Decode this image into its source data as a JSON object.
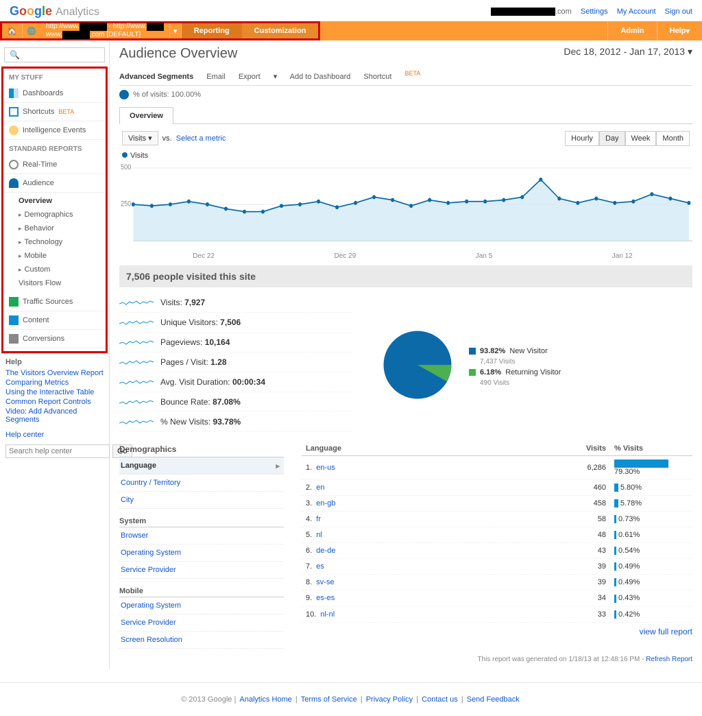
{
  "header": {
    "logo_analytics": "Analytics",
    "email_suffix": ".com",
    "links": {
      "settings": "Settings",
      "my_account": "My Account",
      "sign_out": "Sign out"
    }
  },
  "nav": {
    "breadcrumb_top": "http://www.",
    "breadcrumb_mid": " - http://www.",
    "breadcrumb_bottom": ".com [DEFAULT]",
    "reporting": "Reporting",
    "customization": "Customization",
    "admin": "Admin",
    "help": "Help"
  },
  "sidebar": {
    "my_stuff": "MY STUFF",
    "dashboards": "Dashboards",
    "shortcuts": "Shortcuts",
    "beta": "BETA",
    "intelligence": "Intelligence Events",
    "standard": "STANDARD REPORTS",
    "realtime": "Real-Time",
    "audience": "Audience",
    "sub": {
      "overview": "Overview",
      "demographics": "Demographics",
      "behavior": "Behavior",
      "technology": "Technology",
      "mobile": "Mobile",
      "custom": "Custom",
      "visitors_flow": "Visitors Flow"
    },
    "traffic_sources": "Traffic Sources",
    "content": "Content",
    "conversions": "Conversions",
    "help": "Help",
    "help_links": [
      "The Visitors Overview Report",
      "Comparing Metrics",
      "Using the Interactive Table",
      "Common Report Controls",
      "Video: Add Advanced Segments"
    ],
    "help_center": "Help center",
    "help_placeholder": "Search help center",
    "go": "Go"
  },
  "page": {
    "title": "Audience Overview",
    "date_range": "Dec 18, 2012 - Jan 17, 2013",
    "toolbar": {
      "adv_segments": "Advanced Segments",
      "email": "Email",
      "export": "Export",
      "add_dash": "Add to Dashboard",
      "shortcut": "Shortcut"
    },
    "visits_pct": "% of visits: 100.00%",
    "tab_overview": "Overview",
    "metric_btn": "Visits",
    "vs": "vs.",
    "select_metric": "Select a metric",
    "legend_visits": "Visits",
    "time": {
      "hourly": "Hourly",
      "day": "Day",
      "week": "Week",
      "month": "Month"
    },
    "x_labels": [
      "Dec 22",
      "Dec 29",
      "Jan 5",
      "Jan 12"
    ],
    "y500": "500",
    "y250": "250",
    "summary": "7,506 people visited this site",
    "metrics": [
      {
        "label": "Visits:",
        "value": "7,927"
      },
      {
        "label": "Unique Visitors:",
        "value": "7,506"
      },
      {
        "label": "Pageviews:",
        "value": "10,164"
      },
      {
        "label": "Pages / Visit:",
        "value": "1.28"
      },
      {
        "label": "Avg. Visit Duration:",
        "value": "00:00:34"
      },
      {
        "label": "Bounce Rate:",
        "value": "87.08%"
      },
      {
        "label": "% New Visits:",
        "value": "93.78%"
      }
    ],
    "pie": {
      "new_pct": "93.82%",
      "new_label": "New Visitor",
      "new_sub": "7,437 Visits",
      "ret_pct": "6.18%",
      "ret_label": "Returning Visitor",
      "ret_sub": "490 Visits"
    },
    "dim": {
      "demographics": "Demographics",
      "language": "Language",
      "country": "Country / Territory",
      "city": "City",
      "system": "System",
      "browser": "Browser",
      "os": "Operating System",
      "sp": "Service Provider",
      "mobile": "Mobile",
      "mos": "Operating System",
      "msp": "Service Provider",
      "sr": "Screen Resolution"
    },
    "table": {
      "h_lang": "Language",
      "h_visits": "Visits",
      "h_pct": "% Visits",
      "rows": [
        {
          "n": "1.",
          "lang": "en-us",
          "visits": "6,286",
          "pct": "79.30%",
          "bar": 79.3
        },
        {
          "n": "2.",
          "lang": "en",
          "visits": "460",
          "pct": "5.80%",
          "bar": 5.8
        },
        {
          "n": "3.",
          "lang": "en-gb",
          "visits": "458",
          "pct": "5.78%",
          "bar": 5.78
        },
        {
          "n": "4.",
          "lang": "fr",
          "visits": "58",
          "pct": "0.73%",
          "bar": 0.73
        },
        {
          "n": "5.",
          "lang": "nl",
          "visits": "48",
          "pct": "0.61%",
          "bar": 0.61
        },
        {
          "n": "6.",
          "lang": "de-de",
          "visits": "43",
          "pct": "0.54%",
          "bar": 0.54
        },
        {
          "n": "7.",
          "lang": "es",
          "visits": "39",
          "pct": "0.49%",
          "bar": 0.49
        },
        {
          "n": "8.",
          "lang": "sv-se",
          "visits": "39",
          "pct": "0.49%",
          "bar": 0.49
        },
        {
          "n": "9.",
          "lang": "es-es",
          "visits": "34",
          "pct": "0.43%",
          "bar": 0.43
        },
        {
          "n": "10.",
          "lang": "nl-nl",
          "visits": "33",
          "pct": "0.42%",
          "bar": 0.42
        }
      ],
      "view_full": "view full report"
    },
    "footer_note_prefix": "This report was generated on 1/18/13 at 12:48:16 PM - ",
    "refresh": "Refresh Report"
  },
  "footer": {
    "copyright": "© 2013 Google",
    "links": [
      "Analytics Home",
      "Terms of Service",
      "Privacy Policy",
      "Contact us",
      "Send Feedback"
    ]
  },
  "chart_data": {
    "type": "line",
    "title": "Visits",
    "ylabel": "",
    "ylim": [
      0,
      500
    ],
    "x": [
      "Dec 18",
      "Dec 19",
      "Dec 20",
      "Dec 21",
      "Dec 22",
      "Dec 23",
      "Dec 24",
      "Dec 25",
      "Dec 26",
      "Dec 27",
      "Dec 28",
      "Dec 29",
      "Dec 30",
      "Dec 31",
      "Jan 1",
      "Jan 2",
      "Jan 3",
      "Jan 4",
      "Jan 5",
      "Jan 6",
      "Jan 7",
      "Jan 8",
      "Jan 9",
      "Jan 10",
      "Jan 11",
      "Jan 12",
      "Jan 13",
      "Jan 14",
      "Jan 15",
      "Jan 16",
      "Jan 17"
    ],
    "values": [
      250,
      240,
      250,
      270,
      250,
      220,
      200,
      200,
      240,
      250,
      270,
      230,
      260,
      300,
      280,
      240,
      280,
      260,
      270,
      270,
      280,
      300,
      420,
      290,
      260,
      290,
      260,
      270,
      320,
      290,
      260
    ]
  }
}
